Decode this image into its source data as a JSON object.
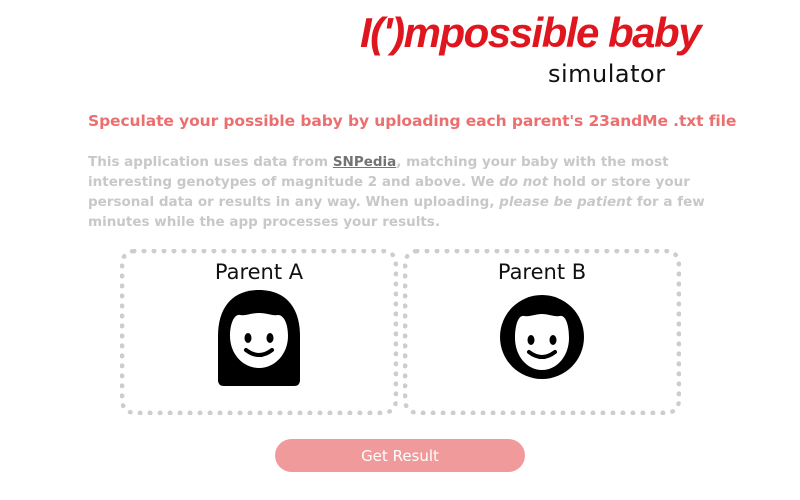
{
  "logo": {
    "main_text": "I(')mpossible baby",
    "sub_text": "simulator",
    "brand_color": "#e0161f"
  },
  "headline": "Speculate your possible baby by uploading each parent's 23andMe .txt file",
  "intro": {
    "part1": "This application uses data from ",
    "link_text": "SNPedia",
    "part2": ", matching your baby with the most interesting genotypes of magnitude 2 and above. We ",
    "emphasis1": "do not",
    "part3": " hold or store your personal data or results in any way. When uploading, ",
    "emphasis2": "please be patient",
    "part4": " for a few minutes while the app processes your results."
  },
  "parents": [
    {
      "label": "Parent A",
      "icon": "woman-face-icon"
    },
    {
      "label": "Parent B",
      "icon": "man-face-icon"
    }
  ],
  "actions": {
    "get_result_label": "Get Result"
  },
  "colors": {
    "headline": "#ec6f6f",
    "intro_text": "#c8c8c8",
    "link": "#737373",
    "button_bg": "#f19a9b",
    "upload_border": "#cdcdcd"
  }
}
